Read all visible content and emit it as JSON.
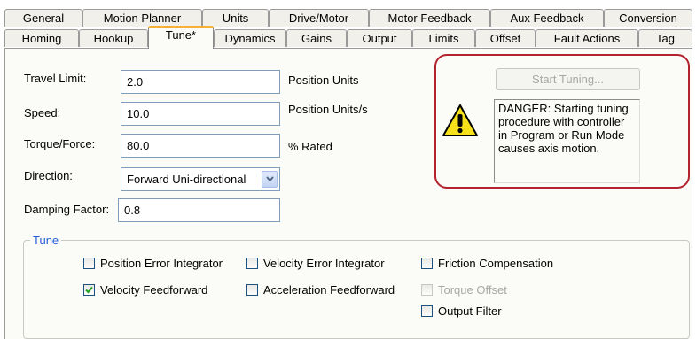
{
  "tabs_row1": [
    {
      "label": "General"
    },
    {
      "label": "Motion Planner"
    },
    {
      "label": "Units"
    },
    {
      "label": "Drive/Motor"
    },
    {
      "label": "Motor Feedback"
    },
    {
      "label": "Aux Feedback"
    },
    {
      "label": "Conversion"
    }
  ],
  "tabs_row2": [
    {
      "label": "Homing"
    },
    {
      "label": "Hookup"
    },
    {
      "label": "Tune*",
      "active": true
    },
    {
      "label": "Dynamics"
    },
    {
      "label": "Gains"
    },
    {
      "label": "Output"
    },
    {
      "label": "Limits"
    },
    {
      "label": "Offset"
    },
    {
      "label": "Fault Actions"
    },
    {
      "label": "Tag"
    }
  ],
  "form": {
    "travel_limit": {
      "label": "Travel Limit:",
      "value": "2.0",
      "unit": "Position Units"
    },
    "speed": {
      "label": "Speed:",
      "value": "10.0",
      "unit": "Position Units/s"
    },
    "torque_force": {
      "label": "Torque/Force:",
      "value": "80.0",
      "unit": "% Rated"
    },
    "direction": {
      "label": "Direction:",
      "value": "Forward Uni-directional"
    },
    "damping_factor": {
      "label": "Damping Factor:",
      "value": "0.8"
    }
  },
  "start_tuning": {
    "label": "Start Tuning...",
    "enabled": false
  },
  "warning": {
    "icon": "warning-icon",
    "message": "DANGER: Starting tuning\nprocedure with controller\nin Program or Run Mode\ncauses axis motion."
  },
  "highlight_color": "#b3232e",
  "tune_group": {
    "title": "Tune",
    "options": {
      "position_error_integrator": {
        "label": "Position Error Integrator",
        "checked": false,
        "enabled": true
      },
      "velocity_error_integrator": {
        "label": "Velocity Error Integrator",
        "checked": false,
        "enabled": true
      },
      "friction_compensation": {
        "label": "Friction Compensation",
        "checked": false,
        "enabled": true
      },
      "velocity_feedforward": {
        "label": "Velocity Feedforward",
        "checked": true,
        "enabled": true
      },
      "acceleration_feedforward": {
        "label": "Acceleration Feedforward",
        "checked": false,
        "enabled": true
      },
      "torque_offset": {
        "label": "Torque Offset",
        "checked": false,
        "enabled": false
      },
      "output_filter": {
        "label": "Output Filter",
        "checked": false,
        "enabled": true
      }
    }
  }
}
